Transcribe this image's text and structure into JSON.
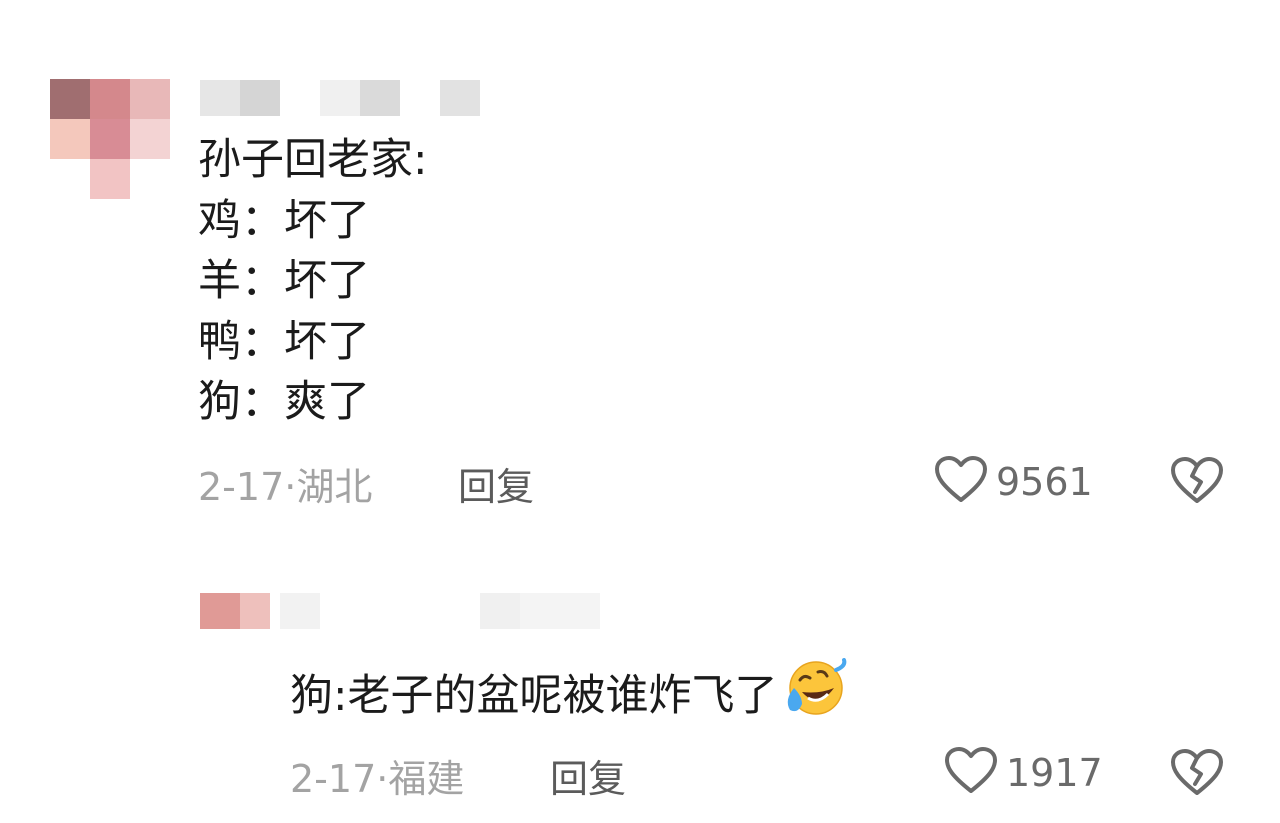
{
  "comments": [
    {
      "text_lines": [
        "孙子回老家:",
        "鸡：坏了",
        "羊：坏了",
        "鸭：坏了",
        "狗：爽了"
      ],
      "date": "2-17",
      "location": "湖北",
      "meta_sep": "·",
      "reply_label": "回复",
      "likes": "9561",
      "like_icon": "heart-outline-icon",
      "dislike_icon": "broken-heart-icon"
    }
  ],
  "replies": [
    {
      "text": "狗:老子的盆呢被谁炸飞了",
      "emoji": "rolling-laughing-emoji",
      "date": "2-17",
      "location": "福建",
      "meta_sep": "·",
      "reply_label": "回复",
      "likes": "1917",
      "like_icon": "heart-outline-icon",
      "dislike_icon": "broken-heart-icon"
    }
  ],
  "colors": {
    "text": "#1b1b1b",
    "meta": "#a3a3a3",
    "icon": "#6a6a6a"
  }
}
